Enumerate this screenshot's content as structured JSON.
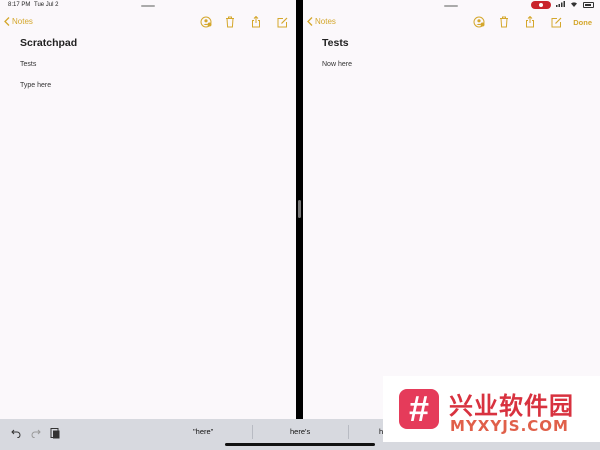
{
  "status": {
    "time": "8:17 PM",
    "date": "Tue Jul 2"
  },
  "colors": {
    "accent": "#d4a72c",
    "background": "#fbf8fb",
    "recording": "#c9232c"
  },
  "left_pane": {
    "back_label": "Notes",
    "toolbar_icons": [
      "share-person-icon",
      "trash-icon",
      "share-icon",
      "compose-icon"
    ],
    "note": {
      "title": "Scratchpad",
      "lines": [
        "Tests",
        "Type here"
      ]
    }
  },
  "right_pane": {
    "back_label": "Notes",
    "toolbar_icons": [
      "share-person-icon",
      "trash-icon",
      "share-icon",
      "compose-icon"
    ],
    "done_label": "Done",
    "note": {
      "title": "Tests",
      "lines": [
        "Now here"
      ]
    }
  },
  "keyboard_bar": {
    "icons": [
      "undo-icon",
      "redo-icon",
      "paste-icon"
    ],
    "suggestions": [
      "\"here\"",
      "here's",
      "h"
    ]
  },
  "watermark": {
    "logo": "#",
    "cn_text": "兴业软件园",
    "en_text": "MYXYJS.COM"
  }
}
